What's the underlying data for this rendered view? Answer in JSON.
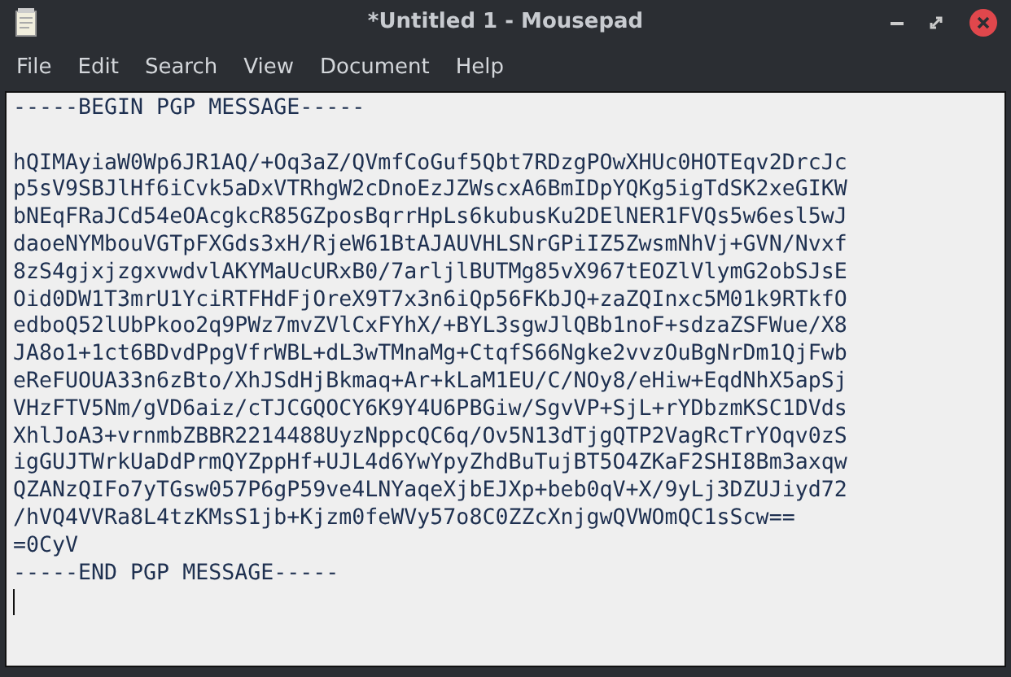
{
  "window": {
    "title": "*Untitled 1 - Mousepad"
  },
  "menu": [
    "File",
    "Edit",
    "Search",
    "View",
    "Document",
    "Help"
  ],
  "editor": {
    "armor_header": "-----BEGIN PGP MESSAGE-----",
    "body_lines": [
      "hQIMAyiaW0Wp6JR1AQ/+Oq3aZ/QVmfCoGuf5Qbt7RDzgPOwXHUc0HOTEqv2DrcJc",
      "p5sV9SBJlHf6iCvk5aDxVTRhgW2cDnoEzJZWscxA6BmIDpYQKg5igTdSK2xeGIKW",
      "bNEqFRaJCd54eOAcgkcR85GZposBqrrHpLs6kubusKu2DElNER1FVQs5w6esl5wJ",
      "daoeNYMbouVGTpFXGds3xH/RjeW61BtAJAUVHLSNrGPiIZ5ZwsmNhVj+GVN/Nvxf",
      "8zS4gjxjzgxvwdvlAKYMaUcURxB0/7arljlBUTMg85vX967tEOZlVlymG2obSJsE",
      "Oid0DW1T3mrU1YciRTFHdFjOreX9T7x3n6iQp56FKbJQ+zaZQInxc5M01k9RTkfO",
      "edboQ52lUbPkoo2q9PWz7mvZVlCxFYhX/+BYL3sgwJlQBb1noF+sdzaZSFWue/X8",
      "JA8o1+1ct6BDvdPpgVfrWBL+dL3wTMnaMg+CtqfS66Ngke2vvzOuBgNrDm1QjFwb",
      "eReFUOUA33n6zBto/XhJSdHjBkmaq+Ar+kLaM1EU/C/NOy8/eHiw+EqdNhX5apSj",
      "VHzFTV5Nm/gVD6aiz/cTJCGQOCY6K9Y4U6PBGiw/SgvVP+SjL+rYDbzmKSC1DVds",
      "XhlJoA3+vrnmbZBBR2214488UyzNppcQC6q/Ov5N13dTjgQTP2VagRcTrYOqv0zS",
      "igGUJTWrkUaDdPrmQYZppHf+UJL4d6YwYpyZhdBuTujBT5O4ZKaF2SHI8Bm3axqw",
      "QZANzQIFo7yTGsw057P6gP59ve4LNYaqeXjbEJXp+beb0qV+X/9yLj3DZUJiyd72",
      "/hVQ4VVRa8L4tzKMsS1jb+Kjzm0feWVy57o8C0ZZcXnjgwQVWOmQC1sScw=="
    ],
    "checksum": "=0CyV",
    "armor_footer": "-----END PGP MESSAGE-----"
  }
}
